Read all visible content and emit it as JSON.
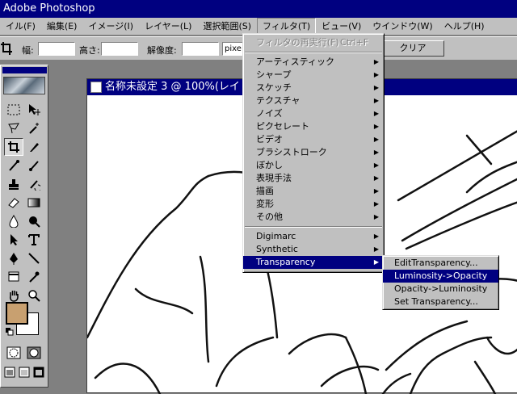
{
  "app": {
    "title": "Adobe Photoshop"
  },
  "menubar": {
    "items": [
      "イル(F)",
      "編集(E)",
      "イメージ(I)",
      "レイヤー(L)",
      "選択範囲(S)",
      "フィルタ(T)",
      "ビュー(V)",
      "ウインドウ(W)",
      "ヘルプ(H)"
    ],
    "active_index": 5
  },
  "options": {
    "width_label": "幅:",
    "width_value": "",
    "height_label": "高さ:",
    "height_value": "",
    "resolution_label": "解像度:",
    "resolution_value": "",
    "unit_value": "pixe",
    "clear_label": "クリア"
  },
  "document": {
    "title": "名称未設定 3 @ 100%(レイ"
  },
  "filter_menu": {
    "repeat_label": "フィルタの再実行(F)",
    "repeat_shortcut": "Ctrl+F",
    "groups": [
      [
        "アーティスティック",
        "シャープ",
        "スケッチ",
        "テクスチャ",
        "ノイズ",
        "ピクセレート",
        "ビデオ",
        "ブラシストローク",
        "ぼかし",
        "表現手法",
        "描画",
        "変形",
        "その他"
      ],
      [
        "Digimarc",
        "Synthetic",
        "Transparency"
      ]
    ],
    "highlighted": "Transparency"
  },
  "transparency_submenu": {
    "items": [
      "EditTransparency...",
      "Luminosity->Opacity",
      "Opacity->Luminosity",
      "Set Transparency..."
    ],
    "highlighted_index": 1
  },
  "colors": {
    "title_bar": "#000080",
    "foreground_swatch": "#c8a070",
    "menu_bg": "#c0c0c0"
  }
}
